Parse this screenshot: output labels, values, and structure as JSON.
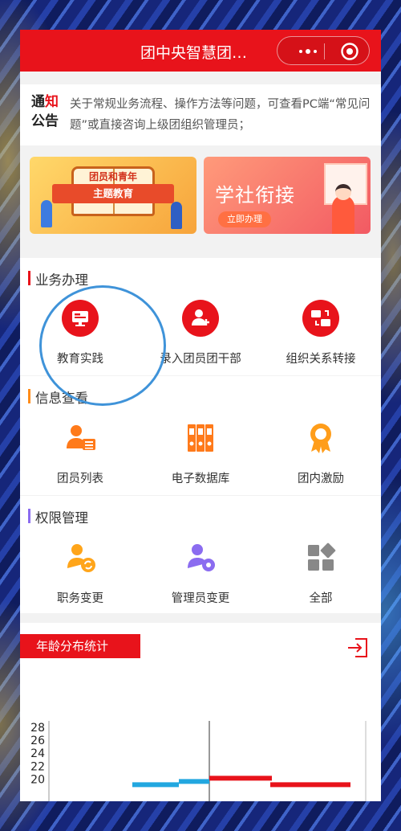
{
  "header": {
    "title": "团中央智慧团…",
    "more_icon": "more-dots-icon",
    "close_icon": "target-circle-icon"
  },
  "notice": {
    "badge_line1_a": "通",
    "badge_line1_b": "知",
    "badge_line2": "公告",
    "text": "关于常规业务流程、操作方法等问题，可查看PC端“常见问题”或直接咨询上级团组织管理员；"
  },
  "banners": [
    {
      "ribbon": "主题教育",
      "heading": "团员和青年",
      "colors": [
        "#ffd86a",
        "#f7a43b"
      ]
    },
    {
      "title": "学社衔接",
      "button": "立即办理",
      "colors": [
        "#ff9a7a",
        "#f25a63"
      ]
    }
  ],
  "sections": {
    "business": {
      "title": "业务办理",
      "accent": "#e8131b",
      "items": [
        {
          "label": "教育实践",
          "icon": "monitor-icon"
        },
        {
          "label": "录入团员团干部",
          "icon": "add-person-icon"
        },
        {
          "label": "组织关系转接",
          "icon": "transfer-folders-icon"
        }
      ]
    },
    "info": {
      "title": "信息查看",
      "accent": "#ff8c1a",
      "items": [
        {
          "label": "团员列表",
          "icon": "member-list-icon"
        },
        {
          "label": "电子数据库",
          "icon": "binders-icon"
        },
        {
          "label": "团内激励",
          "icon": "award-ribbon-icon"
        }
      ]
    },
    "permission": {
      "title": "权限管理",
      "accent": "#8b6cf0",
      "items": [
        {
          "label": "职务变更",
          "icon": "person-switch-icon"
        },
        {
          "label": "管理员变更",
          "icon": "admin-gear-icon"
        },
        {
          "label": "全部",
          "icon": "all-grid-icon"
        }
      ]
    }
  },
  "chart": {
    "title": "年龄分布统计",
    "export_icon": "export-arrow-icon"
  },
  "chart_data": {
    "type": "bar",
    "title": "",
    "y_ticks": [
      28,
      26,
      24,
      22,
      20
    ],
    "series": [
      {
        "color": "#22a7e0",
        "values": [
          19.5,
          20
        ]
      },
      {
        "color": "#e8131b",
        "values": [
          20.5,
          19.5
        ]
      }
    ]
  },
  "colors": {
    "primary": "#e8131b",
    "highlight": "#3f93d9"
  }
}
